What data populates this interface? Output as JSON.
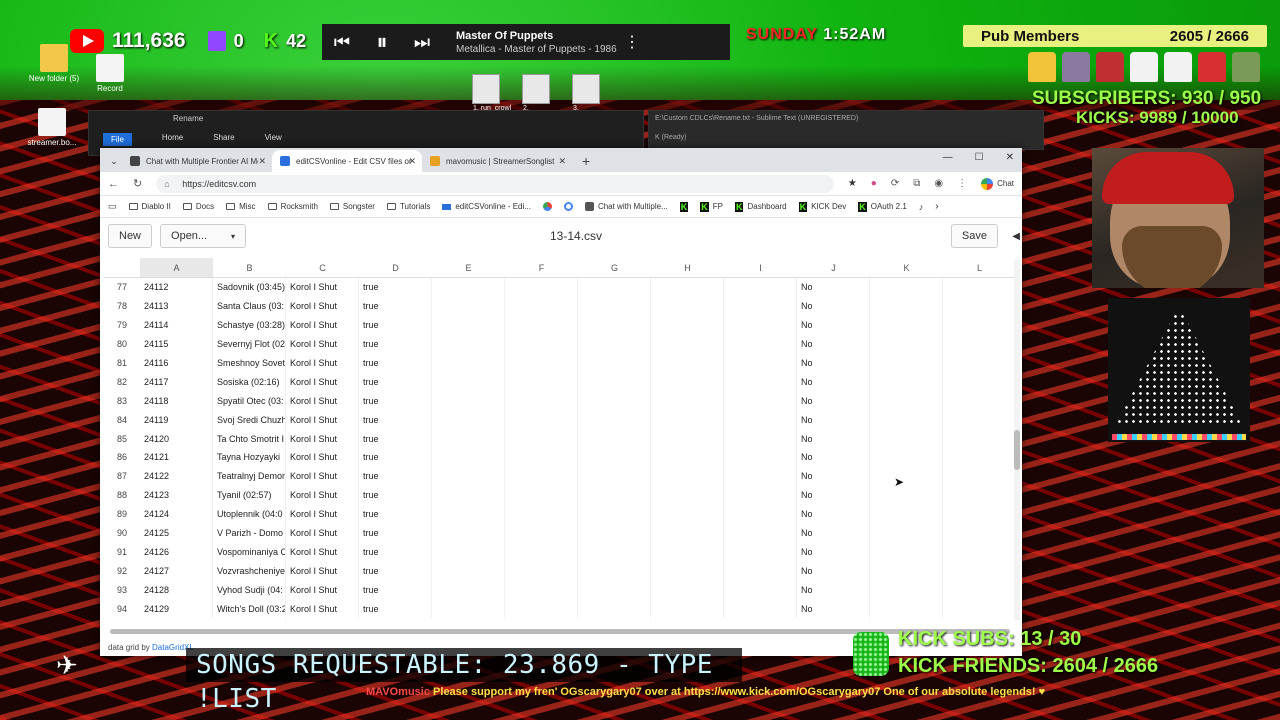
{
  "stream": {
    "youtube_count": "111,636",
    "twitch_count": "0",
    "kick_count": "42",
    "kick_letter": "K",
    "clock_day": "SUNDAY",
    "clock_time": "1:52AM",
    "pub_members_label": "Pub Members",
    "pub_members_value": "2605 / 2666",
    "subscribers": "SUBSCRIBERS: 930 / 950",
    "kicks": "KICKS: 9989 / 10000",
    "songs_requestable": "SONGS REQUESTABLE: 23.869 - TYPE !LIST",
    "kick_subs": "KICK SUBS: 13 / 30",
    "kick_friends": "KICK FRIENDS: 2604 / 2666",
    "ticker_user": "MAVOmusic",
    "ticker_text": "Please support my fren' OGscarygary07 over at https://www.kick.com/OGscarygary07 One of our absolute legends! ♥",
    "accent_green": "#9dff4a",
    "accent_red": "#ff2424"
  },
  "player": {
    "title": "Master Of Puppets",
    "subtitle": "Metallica - Master of Puppets - 1986",
    "prev_icon": "⏮",
    "pause_icon": "⏸",
    "next_icon": "⏭"
  },
  "taskbar_thumbs": [
    "1. run_crowl",
    "2. generate...",
    "3. apply_re..."
  ],
  "desktop": {
    "new_folder": "New folder (5)",
    "record": "Record",
    "streamer_bot": "streamer.bo..."
  },
  "bg_windows": {
    "explorer_title": "Rename",
    "explorer_tabs": [
      "File",
      "Home",
      "Share",
      "View"
    ],
    "sublime_title": "E:\\Custom CDLCs\\Rename.txt - Sublime Text (UNREGISTERED)",
    "sublime_status": "K (Ready)"
  },
  "browser": {
    "tabs": [
      {
        "label": "Chat with Multiple Frontier AI Mo...",
        "active": false
      },
      {
        "label": "editCSVonline - Edit CSV files onli...",
        "active": true
      },
      {
        "label": "mavomusic | StreamerSonglist",
        "active": false
      }
    ],
    "url": "https://editcsv.com",
    "chat_label": "Chat",
    "bookmarks": [
      {
        "label": "Diablo II",
        "kind": "folder"
      },
      {
        "label": "Docs",
        "kind": "folder"
      },
      {
        "label": "Misc",
        "kind": "folder"
      },
      {
        "label": "Rocksmith",
        "kind": "folder"
      },
      {
        "label": "Songster",
        "kind": "folder"
      },
      {
        "label": "Tutorials",
        "kind": "folder"
      },
      {
        "label": "editCSVonline - Edi...",
        "kind": "site"
      },
      {
        "label": "",
        "kind": "site"
      },
      {
        "label": "",
        "kind": "site"
      },
      {
        "label": "Chat with Multiple...",
        "kind": "site"
      },
      {
        "label": "",
        "kind": "kick"
      },
      {
        "label": "FP",
        "kind": "kick"
      },
      {
        "label": "Dashboard",
        "kind": "kick"
      },
      {
        "label": "KICK Dev",
        "kind": "kick"
      },
      {
        "label": "OAuth 2.1",
        "kind": "kick"
      }
    ]
  },
  "editor": {
    "new_label": "New",
    "open_label": "Open...",
    "filename": "13-14.csv",
    "save_label": "Save",
    "footer_prefix": "data grid by ",
    "footer_link": "DataGridXL"
  },
  "grid": {
    "columns": [
      "A",
      "B",
      "C",
      "D",
      "E",
      "F",
      "G",
      "H",
      "I",
      "J",
      "K",
      "L"
    ],
    "rows": [
      [
        "77",
        "24112",
        "Sadovnik (03:45)",
        "Korol I Shut",
        "true",
        "No"
      ],
      [
        "78",
        "24113",
        "Santa Claus (03:",
        "Korol I Shut",
        "true",
        "No"
      ],
      [
        "79",
        "24114",
        "Schastye (03:28)",
        "Korol I Shut",
        "true",
        "No"
      ],
      [
        "80",
        "24115",
        "Severnyj Flot (02",
        "Korol I Shut",
        "true",
        "No"
      ],
      [
        "81",
        "24116",
        "Smeshnoy Sovet",
        "Korol I Shut",
        "true",
        "No"
      ],
      [
        "82",
        "24117",
        "Sosiska (02:16)",
        "Korol I Shut",
        "true",
        "No"
      ],
      [
        "83",
        "24118",
        "Spyatil Otec (03:",
        "Korol I Shut",
        "true",
        "No"
      ],
      [
        "84",
        "24119",
        "Svoj Sredi Chuzh",
        "Korol I Shut",
        "true",
        "No"
      ],
      [
        "85",
        "24120",
        "Ta Chto Smotrit I",
        "Korol I Shut",
        "true",
        "No"
      ],
      [
        "86",
        "24121",
        "Tayna Hozyayki",
        "Korol I Shut",
        "true",
        "No"
      ],
      [
        "87",
        "24122",
        "Teatralnyj Demon",
        "Korol I Shut",
        "true",
        "No"
      ],
      [
        "88",
        "24123",
        "Tyanil (02:57)",
        "Korol I Shut",
        "true",
        "No"
      ],
      [
        "89",
        "24124",
        "Utoplennik (04:0",
        "Korol I Shut",
        "true",
        "No"
      ],
      [
        "90",
        "24125",
        "V Parizh - Domo",
        "Korol I Shut",
        "true",
        "No"
      ],
      [
        "91",
        "24126",
        "Vospominaniya C",
        "Korol I Shut",
        "true",
        "No"
      ],
      [
        "92",
        "24127",
        "Vozvrashcheniye",
        "Korol I Shut",
        "true",
        "No"
      ],
      [
        "93",
        "24128",
        "Vyhod Sudji (04:",
        "Korol I Shut",
        "true",
        "No"
      ],
      [
        "94",
        "24129",
        "Witch's Doll (03:2",
        "Korol I Shut",
        "true",
        "No"
      ]
    ]
  }
}
